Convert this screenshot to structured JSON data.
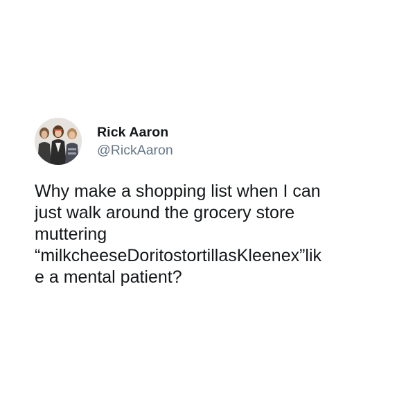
{
  "author": {
    "display_name": "Rick Aaron",
    "handle": "@RickAaron",
    "avatar_icon": "band-photo-avatar"
  },
  "tweet": {
    "lines": [
      "Why make a shopping list when I can",
      "just walk around the grocery store",
      "muttering",
      "“milkcheeseDoritostortillasKleenex”lik",
      "e a mental patient?"
    ]
  },
  "colors": {
    "background": "#ffffff",
    "name": "#14171a",
    "handle": "#657786"
  }
}
